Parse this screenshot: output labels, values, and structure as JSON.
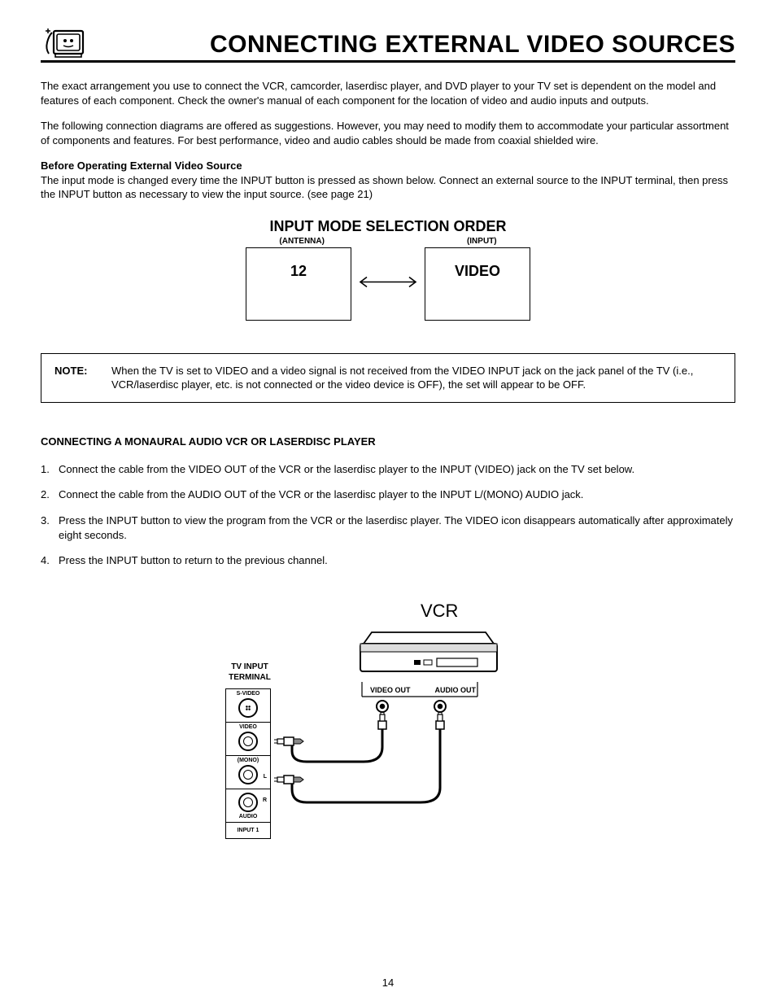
{
  "header": {
    "title": "CONNECTING EXTERNAL VIDEO SOURCES"
  },
  "intro": {
    "p1": "The exact arrangement you use to connect the VCR, camcorder, laserdisc player, and DVD player to your TV set is dependent on the model and features of each component.  Check the owner's manual of each component for the location of video and audio inputs and outputs.",
    "p2": "The following connection diagrams are offered as suggestions.  However, you may need to modify them to accommodate your particular assortment of components and features.  For best performance, video and audio cables should be made from coaxial shielded wire."
  },
  "before": {
    "heading": "Before Operating External Video Source",
    "text": "The input mode is changed every time the INPUT button is pressed as shown below.  Connect an external source to the INPUT terminal, then press the INPUT button as necessary to view the input source.  (see page 21)"
  },
  "inputMode": {
    "title": "INPUT MODE SELECTION ORDER",
    "leftLabel": "(ANTENNA)",
    "rightLabel": "(INPUT)",
    "leftBox": "12",
    "rightBox": "VIDEO"
  },
  "note": {
    "label": "NOTE:",
    "text": "When the TV is set to VIDEO and a video signal is not received from the VIDEO INPUT jack on the jack panel of the TV (i.e., VCR/laserdisc player, etc. is not connected or the video device is OFF), the set will appear to be OFF."
  },
  "monaural": {
    "heading": "CONNECTING A MONAURAL AUDIO VCR OR LASERDISC PLAYER",
    "steps": [
      "Connect the cable from the VIDEO OUT of the VCR or the laserdisc player to the INPUT (VIDEO) jack on the TV set below.",
      "Connect the cable from the AUDIO OUT of the VCR or the laserdisc player to the INPUT L/(MONO) AUDIO jack.",
      "Press the INPUT button to view the program from the VCR or the laserdisc player.  The VIDEO icon disappears automatically after approximately eight seconds.",
      "Press the INPUT button to return to the previous channel."
    ]
  },
  "diagram": {
    "vcrTitle": "VCR",
    "tvTerminal": "TV INPUT TERMINAL",
    "svideo": "S-VIDEO",
    "video": "VIDEO",
    "mono": "(MONO)",
    "l": "L",
    "r": "R",
    "audio": "AUDIO",
    "input1": "INPUT 1",
    "videoOut": "VIDEO OUT",
    "audioOut": "AUDIO OUT"
  },
  "pageNumber": "14"
}
